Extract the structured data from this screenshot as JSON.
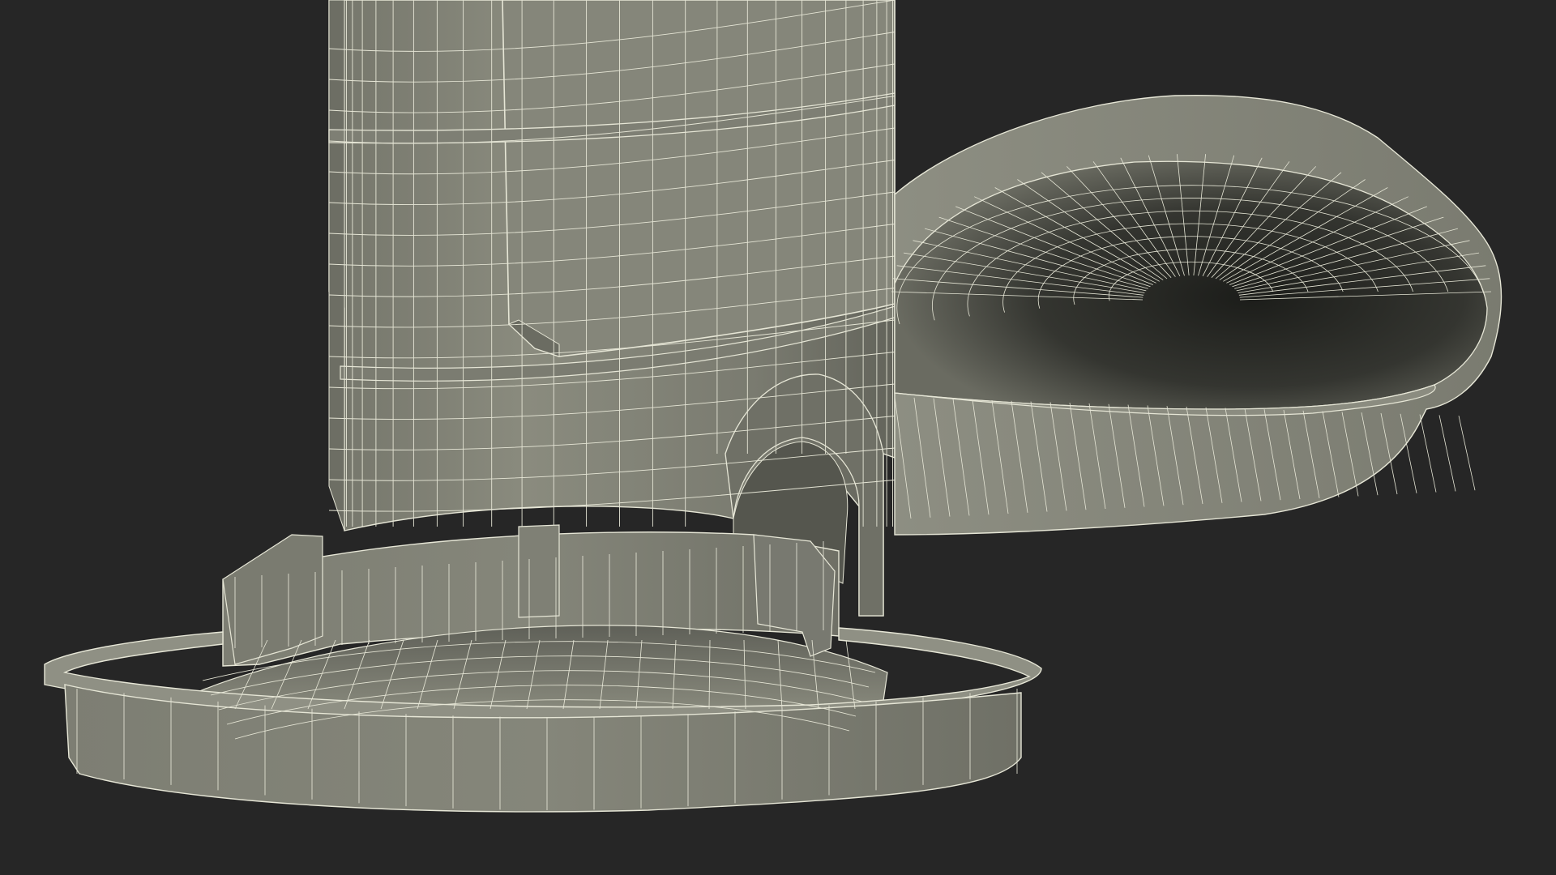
{
  "scene": {
    "subject": "",
    "colors": {
      "background": "#262626",
      "surface_light": "#878879",
      "surface_mid": "#74756a",
      "surface_dark": "#4f5049",
      "interior_dark": "#1e1f1c",
      "wire": "#e6e6d6"
    }
  }
}
